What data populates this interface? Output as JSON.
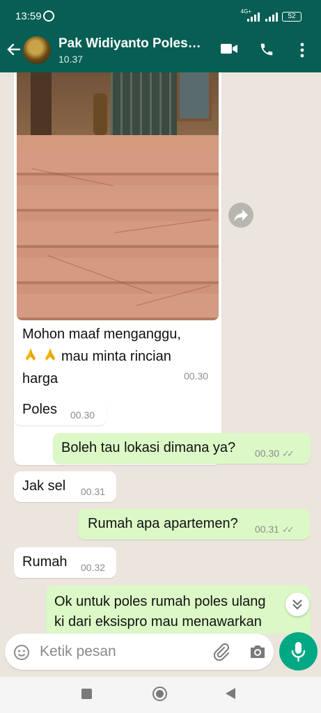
{
  "status_bar": {
    "time": "13:59",
    "network": "4G+",
    "battery": "52"
  },
  "header": {
    "contact_name": "Pak Widiyanto Poles…",
    "last_seen": "10.37"
  },
  "messages": [
    {
      "direction": "in",
      "type": "image",
      "caption_line1": "Mohon maaf menganggu,",
      "caption_line2": "mau minta rincian",
      "caption_line3": "harga",
      "emoji": "folded-hands",
      "time": "00.30"
    },
    {
      "direction": "in",
      "text": "Poles",
      "time": "00.30"
    },
    {
      "direction": "out",
      "text": "Boleh tau lokasi dimana ya?",
      "time": "00.30",
      "status": "read"
    },
    {
      "direction": "in",
      "text": "Jak sel",
      "time": "00.31"
    },
    {
      "direction": "out",
      "text": "Rumah apa apartemen?",
      "time": "00.31",
      "status": "read"
    },
    {
      "direction": "in",
      "text": "Rumah",
      "time": "00.32"
    },
    {
      "direction": "out",
      "text_line1": "Ok untuk poles rumah poles ulang",
      "text_line2": "ki dari eksispro mau menawarkan"
    }
  ],
  "composer": {
    "placeholder": "Ketik pesan"
  },
  "colors": {
    "header": "#075e54",
    "chat_bg": "#ece5dd",
    "outgoing_bubble": "#dcf8c6",
    "incoming_bubble": "#ffffff",
    "accent": "#00a884",
    "read_ticks": "#8c9ca0"
  },
  "icons": {
    "back": "arrow-left-icon",
    "video": "video-camera-icon",
    "call": "phone-icon",
    "menu": "three-dots-icon",
    "forward": "forward-arrow-icon",
    "scroll": "chevron-double-down-icon",
    "emoji": "smiley-icon",
    "attach": "paperclip-icon",
    "camera": "camera-icon",
    "mic": "microphone-icon"
  }
}
